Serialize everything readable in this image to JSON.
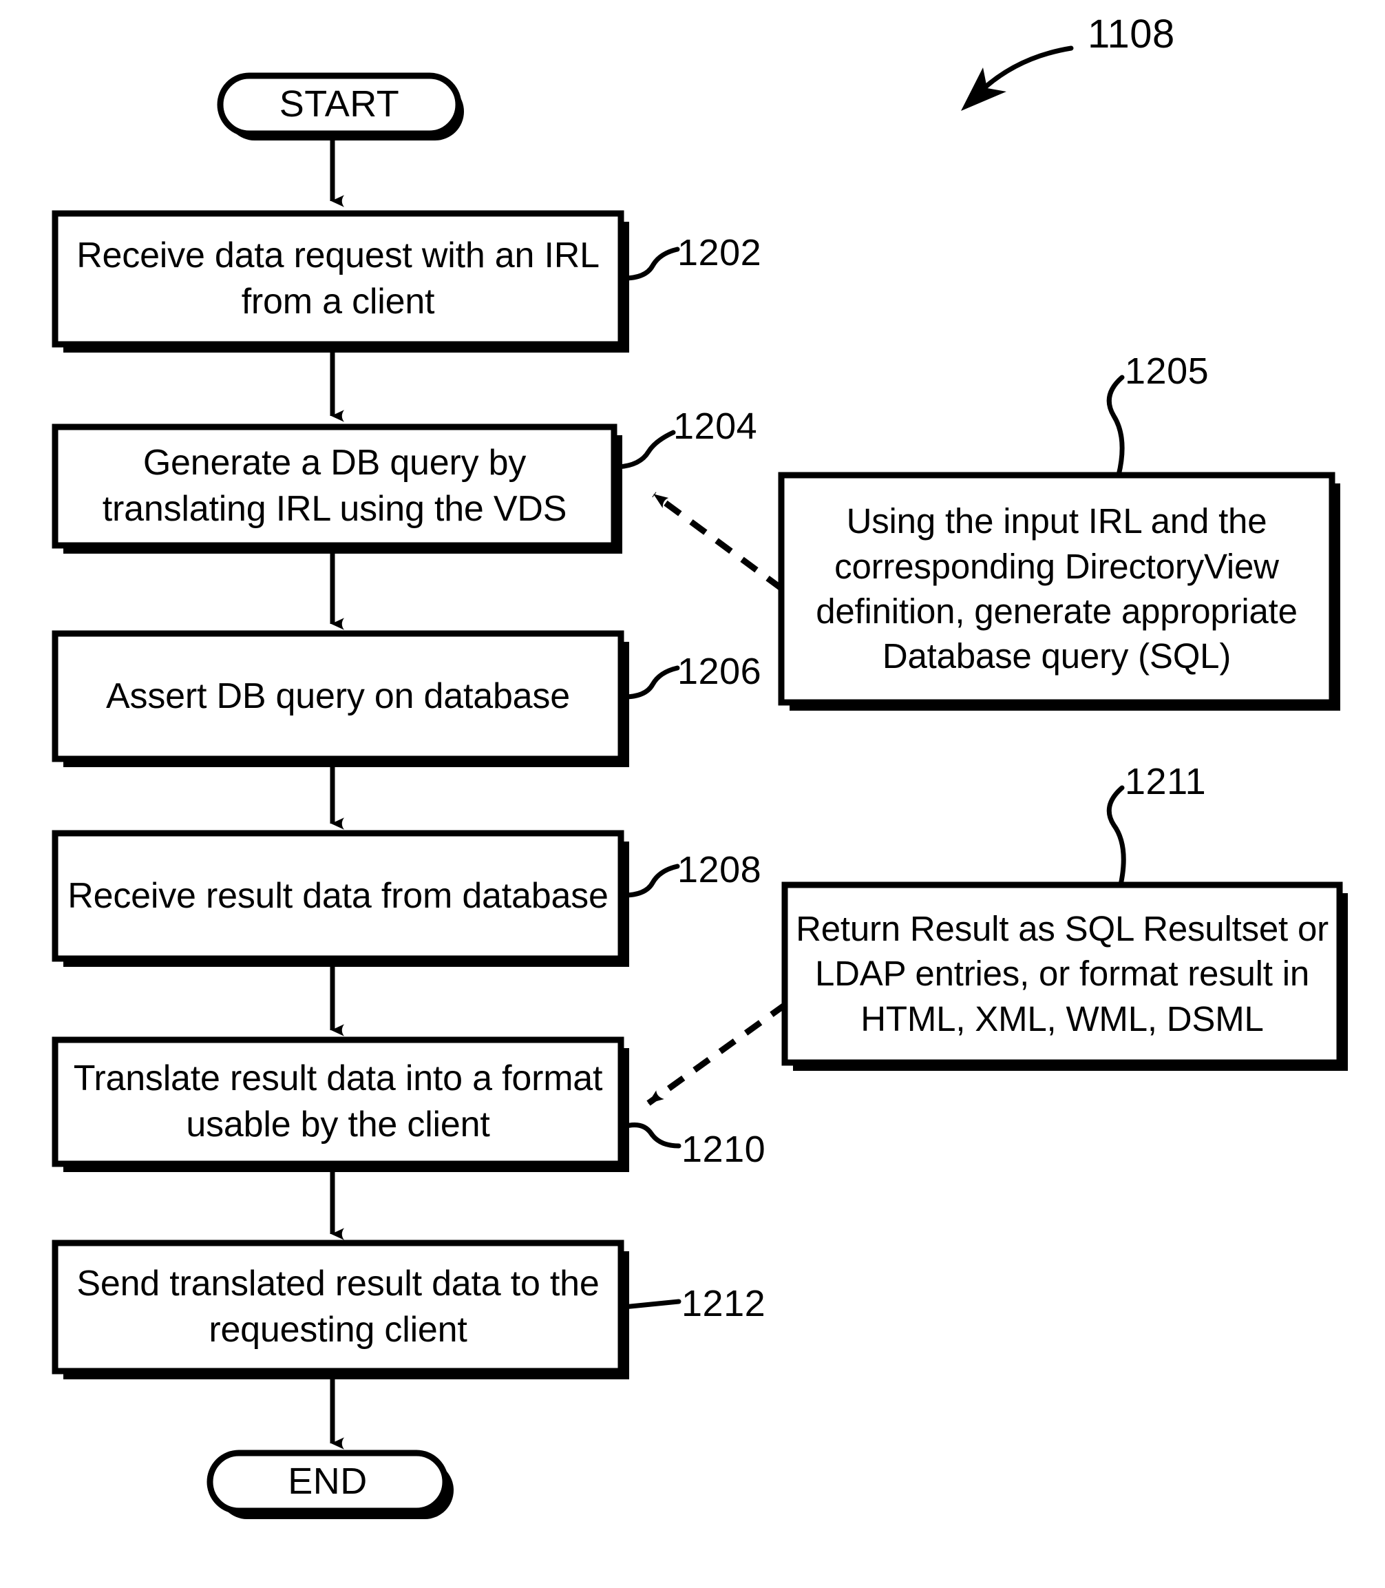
{
  "figure": {
    "label": "1108",
    "kind": "flowchart"
  },
  "terminals": {
    "start": "START",
    "end": "END"
  },
  "steps": [
    {
      "ref": "1202",
      "text": "Receive data request with an IRL\nfrom a client"
    },
    {
      "ref": "1204",
      "text": "Generate a DB query by\ntranslating IRL using the VDS"
    },
    {
      "ref": "1206",
      "text": "Assert DB query on database"
    },
    {
      "ref": "1208",
      "text": "Receive result data from database"
    },
    {
      "ref": "1210",
      "text": "Translate result data into a format\nusable by the client"
    },
    {
      "ref": "1212",
      "text": "Send translated result data to the\nrequesting client"
    }
  ],
  "notes": [
    {
      "ref": "1205",
      "text": "Using the input IRL and the\ncorresponding DirectoryView\ndefinition, generate appropriate\nDatabase query (SQL)"
    },
    {
      "ref": "1211",
      "text": "Return Result as SQL Resultset or\nLDAP entries, or format result in\nHTML, XML, WML, DSML"
    }
  ],
  "colors": {
    "ink": "#000000",
    "paper": "#ffffff"
  }
}
